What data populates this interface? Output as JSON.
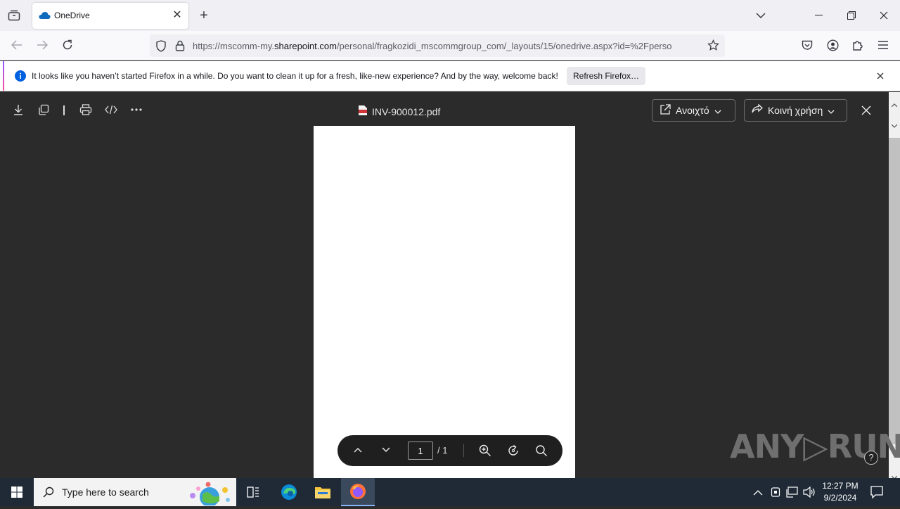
{
  "browser": {
    "tab_title": "OneDrive",
    "url_prefix": "https://mscomm-my.",
    "url_domain": "sharepoint.com",
    "url_rest": "/personal/fragkozidi_mscommgroup_com/_layouts/15/onedrive.aspx?id=%2Fperso"
  },
  "notification": {
    "message": "It looks like you haven’t started Firefox in a while. Do you want to clean it up for a fresh, like-new experience? And by the way, welcome back!",
    "refresh_label": "Refresh Firefox…"
  },
  "viewer": {
    "filename": "INV-900012.pdf",
    "open_label": "Ανοιχτό",
    "share_label": "Κοινή χρήση",
    "page_current": "1",
    "page_total": "/ 1"
  },
  "watermark": "ANY▷RUN",
  "taskbar": {
    "search_placeholder": "Type here to search",
    "time": "12:27 PM",
    "date": "9/2/2024"
  },
  "colors": {
    "viewer_bg": "#2b2b2b",
    "taskbar_bg": "#1f2a36",
    "firefox_accent": "#9059ff"
  }
}
